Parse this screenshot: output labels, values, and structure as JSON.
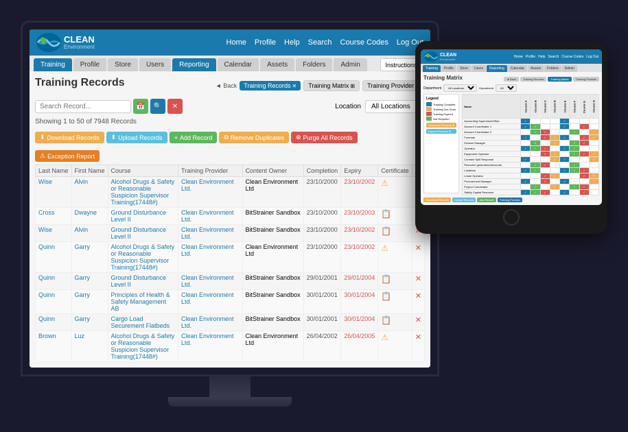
{
  "monitor": {
    "app": {
      "logo_text": "CLEAN",
      "logo_sub": "Environment",
      "nav_links": [
        "Home",
        "Profile",
        "Help",
        "Search",
        "Course Codes",
        "Log Out"
      ],
      "tabs": [
        {
          "label": "Training",
          "active": true
        },
        {
          "label": "Profile"
        },
        {
          "label": "Store"
        },
        {
          "label": "Users"
        },
        {
          "label": "Reporting",
          "highlight": true
        },
        {
          "label": "Calendar"
        },
        {
          "label": "Assets"
        },
        {
          "label": "Folders"
        },
        {
          "label": "Admin"
        }
      ],
      "instructions_btn": "Instructions",
      "page_title": "Training Records",
      "nav_back": "Back",
      "nav_training_records": "Training Records",
      "nav_training_matrix": "Training Matrix",
      "nav_training_provider": "Training Provider",
      "search_placeholder": "Search Record...",
      "location_label": "Location",
      "location_value": "All Locations",
      "records_info": "Showing 1 to 50 of 7948 Records",
      "action_buttons": [
        {
          "label": "Download Records",
          "color": "orange"
        },
        {
          "label": "Upload Records",
          "color": "teal"
        },
        {
          "label": "Add Record",
          "color": "green"
        },
        {
          "label": "Remove Duplicates",
          "color": "orange"
        },
        {
          "label": "Purge All Records",
          "color": "red"
        }
      ],
      "exception_btn": "Exception Report",
      "table_headers": [
        "Last Name",
        "First Name",
        "Course",
        "Training Provider",
        "Content Owner",
        "Completion",
        "Expiry",
        "Certificate",
        "A"
      ],
      "table_rows": [
        {
          "last": "Wise",
          "first": "Alvin",
          "course": "Alcohol Drugs & Safety or Reasonable Suspicion Supervisor Training(17448#)",
          "provider": "Clean Environment Ltd.",
          "owner": "Clean Environment Ltd",
          "completion": "23/10/2000",
          "expiry": "23/10/2002",
          "cert": "warn"
        },
        {
          "last": "Cross",
          "first": "Dwayne",
          "course": "Ground Disturbance Level II",
          "provider": "Clean Environment Ltd.",
          "owner": "BitStrainer Sandbox",
          "completion": "23/10/2000",
          "expiry": "23/10/2003",
          "cert": "icon"
        },
        {
          "last": "Wise",
          "first": "Alvin",
          "course": "Ground Disturbance Level II",
          "provider": "Clean Environment Ltd.",
          "owner": "BitStrainer Sandbox",
          "completion": "23/10/2000",
          "expiry": "23/10/2002",
          "cert": "icon"
        },
        {
          "last": "Quinn",
          "first": "Garry",
          "course": "Alcohol Drugs & Safety or Reasonable Suspicion Supervisor Training(17448#)",
          "provider": "Clean Environment Ltd.",
          "owner": "Clean Environment Ltd",
          "completion": "23/10/2000",
          "expiry": "23/10/2002",
          "cert": "warn"
        },
        {
          "last": "Quinn",
          "first": "Garry",
          "course": "Ground Disturbance Level II",
          "provider": "Clean Environment Ltd.",
          "owner": "BitStrainer Sandbox",
          "completion": "29/01/2001",
          "expiry": "29/01/2004",
          "cert": "icon"
        },
        {
          "last": "Quinn",
          "first": "Garry",
          "course": "Principles of Health & Safety Management AB",
          "provider": "Clean Environment Ltd.",
          "owner": "BitStrainer Sandbox",
          "completion": "30/01/2001",
          "expiry": "30/01/2004",
          "cert": "icon"
        },
        {
          "last": "Quinn",
          "first": "Garry",
          "course": "Cargo Load Securement Flatbeds",
          "provider": "Clean Environment Ltd.",
          "owner": "BitStrainer Sandbox",
          "completion": "30/01/2001",
          "expiry": "30/01/2004",
          "cert": "icon"
        },
        {
          "last": "Brown",
          "first": "Luz",
          "course": "Alcohol Drugs & Safety or Reasonable Suspicion Supervisor Training(17448#)",
          "provider": "Clean Environment Ltd.",
          "owner": "Clean Environment Ltd",
          "completion": "26/04/2002",
          "expiry": "26/04/2005",
          "cert": "warn"
        }
      ]
    }
  },
  "tablet": {
    "app": {
      "logo_text": "CLEAN",
      "logo_sub": "Environment",
      "nav_links": [
        "Home",
        "Profile",
        "Help",
        "Search",
        "Course Codes",
        "Log Out"
      ],
      "tabs": [
        "Training",
        "Profile",
        "Store",
        "Users",
        "Reporting",
        "Calendar",
        "Assets",
        "Folders",
        "Admin"
      ],
      "page_title": "Training Matrix",
      "nav_back": "Back",
      "location_label": "Department",
      "location_value": "All Locations",
      "legend": {
        "title": "Legend",
        "items": [
          {
            "color": "#1a7aad",
            "label": "Training Complete"
          },
          {
            "color": "#f0ad4e",
            "label": "Training Due Soon"
          },
          {
            "color": "#d9534f",
            "label": "Training Expired"
          },
          {
            "color": "#5cb85c",
            "label": "Not Required"
          }
        ]
      },
      "action_btns": [
        "Download Records",
        "Upload Records",
        "Add Record",
        "Training Provider"
      ]
    }
  }
}
